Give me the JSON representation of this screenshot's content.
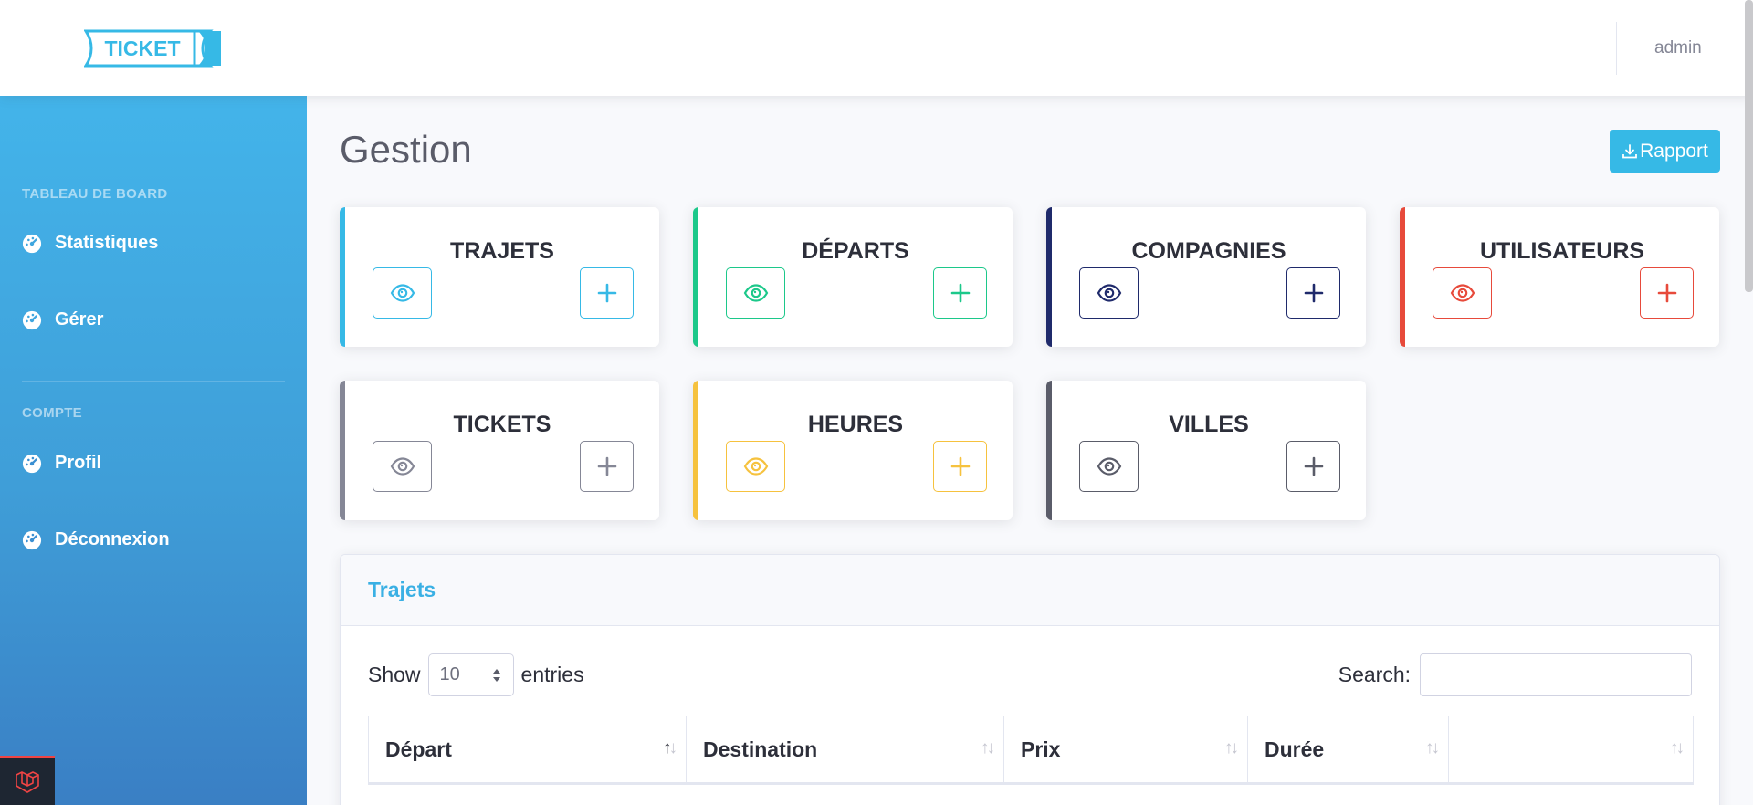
{
  "header": {
    "logo_text": "TICKET",
    "user": "admin"
  },
  "sidebar": {
    "headings": [
      "TABLEAU DE BOARD",
      "COMPTE"
    ],
    "items": [
      {
        "label": "Statistiques",
        "icon": "dashboard-icon"
      },
      {
        "label": "Gérer",
        "icon": "dashboard-icon"
      },
      {
        "label": "Profil",
        "icon": "dashboard-icon"
      },
      {
        "label": "Déconnexion",
        "icon": "dashboard-icon"
      }
    ]
  },
  "main": {
    "title": "Gestion",
    "report_button": "Rapport"
  },
  "cards": [
    {
      "title": "TRAJETS",
      "color": "#36b9e6"
    },
    {
      "title": "DÉPARTS",
      "color": "#1cc88a"
    },
    {
      "title": "COMPAGNIES",
      "color": "#1f2a6b"
    },
    {
      "title": "UTILISATEURS",
      "color": "#e74a3b"
    },
    {
      "title": "TICKETS",
      "color": "#858796"
    },
    {
      "title": "HEURES",
      "color": "#f6c23e"
    },
    {
      "title": "VILLES",
      "color": "#5a5c69"
    }
  ],
  "table": {
    "title": "Trajets",
    "show_label": "Show",
    "entries_value": "10",
    "entries_label": "entries",
    "search_label": "Search:",
    "columns": [
      "Départ",
      "Destination",
      "Prix",
      "Durée",
      ""
    ]
  },
  "colors": {
    "sidebar_top": "#43b4ea",
    "sidebar_bottom": "#3a7fc4",
    "accent": "#36b9e6"
  }
}
